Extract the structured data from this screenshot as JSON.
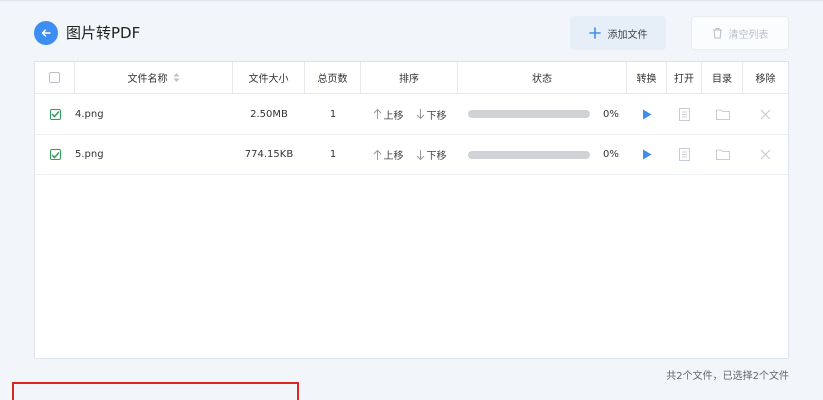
{
  "header": {
    "title": "图片转PDF",
    "add_label": "添加文件",
    "clear_label": "清空列表"
  },
  "table": {
    "columns": {
      "name": "文件名称",
      "size": "文件大小",
      "pages": "总页数",
      "order": "排序",
      "status": "状态",
      "convert": "转换",
      "open": "打开",
      "directory": "目录",
      "remove": "移除"
    },
    "move_up_label": "上移",
    "move_down_label": "下移",
    "rows": [
      {
        "name": "4.png",
        "size": "2.50MB",
        "pages": "1",
        "progress": "0%",
        "progress_value": 0,
        "checked": true
      },
      {
        "name": "5.png",
        "size": "774.15KB",
        "pages": "1",
        "progress": "0%",
        "progress_value": 0,
        "checked": true
      }
    ]
  },
  "footer": {
    "summary": "共2个文件，已选择2个文件"
  },
  "colors": {
    "accent": "#3d8ef0",
    "check": "#2f9e5a",
    "highlight_box": "#e02424"
  }
}
